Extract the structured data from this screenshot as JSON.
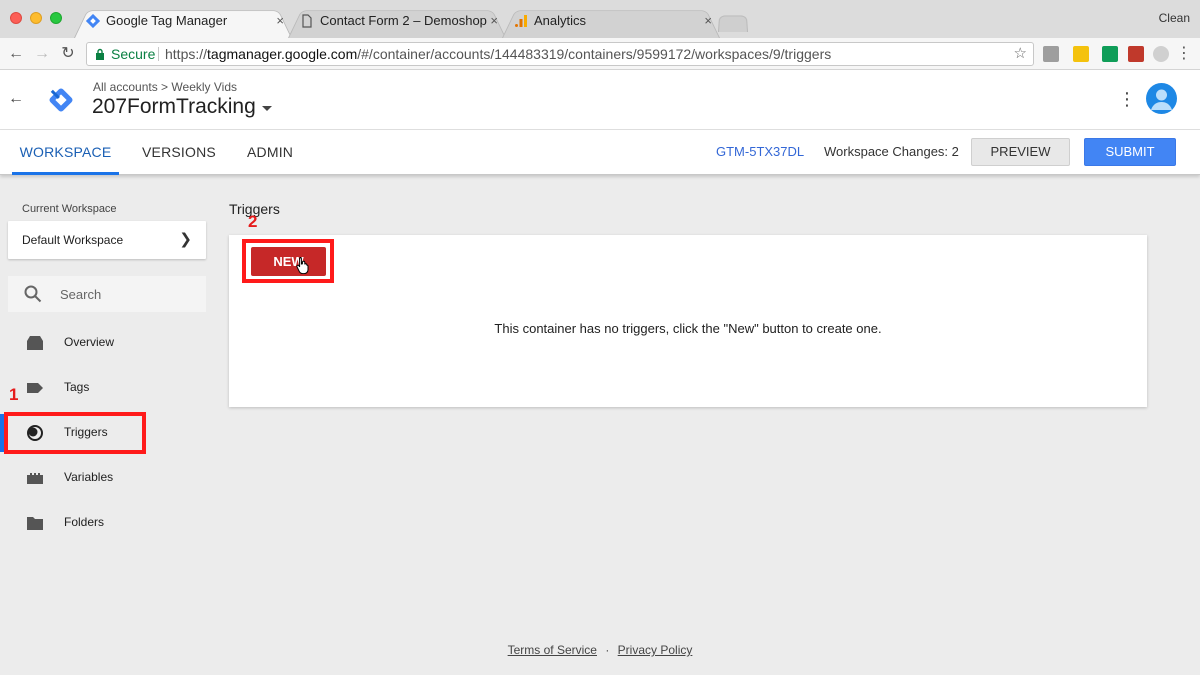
{
  "browser": {
    "tabs": [
      {
        "title": "Google Tag Manager",
        "active": true
      },
      {
        "title": "Contact Form 2 – Demoshop",
        "active": false
      },
      {
        "title": "Analytics",
        "active": false
      }
    ],
    "profile": "Clean",
    "secure_label": "Secure",
    "url_prefix": "https://",
    "url_host": "tagmanager.google.com",
    "url_path": "/#/container/accounts/144483319/containers/9599172/workspaces/9/triggers",
    "close_glyph": "×"
  },
  "header": {
    "breadcrumb_account": "All accounts",
    "breadcrumb_sep": ">",
    "breadcrumb_container": "Weekly Vids",
    "container_name": "207FormTracking"
  },
  "tabs": {
    "workspace": "WORKSPACE",
    "versions": "VERSIONS",
    "admin": "ADMIN"
  },
  "toolbar": {
    "container_id": "GTM-5TX37DL",
    "workspace_changes": "Workspace Changes: 2",
    "preview_label": "PREVIEW",
    "submit_label": "SUBMIT"
  },
  "sidebar": {
    "current_workspace_label": "Current Workspace",
    "workspace_name": "Default Workspace",
    "search_placeholder": "Search",
    "items": [
      {
        "label": "Overview",
        "icon": "overview-icon"
      },
      {
        "label": "Tags",
        "icon": "tag-icon"
      },
      {
        "label": "Triggers",
        "icon": "trigger-icon"
      },
      {
        "label": "Variables",
        "icon": "variables-icon"
      },
      {
        "label": "Folders",
        "icon": "folder-icon"
      }
    ],
    "active_item": "Triggers"
  },
  "main": {
    "section_title": "Triggers",
    "new_button": "NEW",
    "empty_message": "This container has no triggers, click the \"New\" button to create one."
  },
  "annotations": {
    "step1": "1",
    "step2": "2",
    "color": "#ff1a1a"
  },
  "footer": {
    "terms": "Terms of Service",
    "dot": "·",
    "privacy": "Privacy Policy"
  },
  "colors": {
    "accent_blue": "#1a73e8",
    "submit_blue": "#4285f4",
    "new_button_red": "#c62828"
  }
}
